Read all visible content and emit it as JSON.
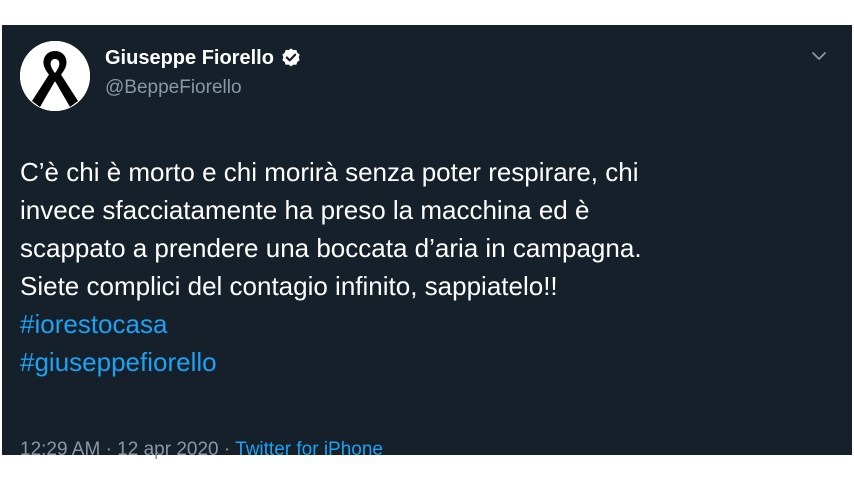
{
  "tweet": {
    "author": {
      "name": "Giuseppe Fiorello",
      "handle": "@BeppeFiorello",
      "verified": true,
      "avatar_icon": "black-mourning-ribbon"
    },
    "text_lines": [
      "C’è chi è morto e chi morirà senza poter respirare, chi",
      "invece sfacciatamente ha preso la macchina ed è",
      "scappato a prendere una boccata d’aria in campagna.",
      "Siete complici del contagio infinito, sappiatelo!!"
    ],
    "hashtags": [
      "#iorestocasa",
      "#giuseppefiorello"
    ],
    "time": "12:29 AM",
    "date": "12 apr 2020",
    "separator": "·",
    "source": "Twitter for iPhone"
  },
  "colors": {
    "card_background": "#15202b",
    "primary_text": "#ffffff",
    "secondary_text": "#8899a6",
    "link": "#1da1f2"
  }
}
